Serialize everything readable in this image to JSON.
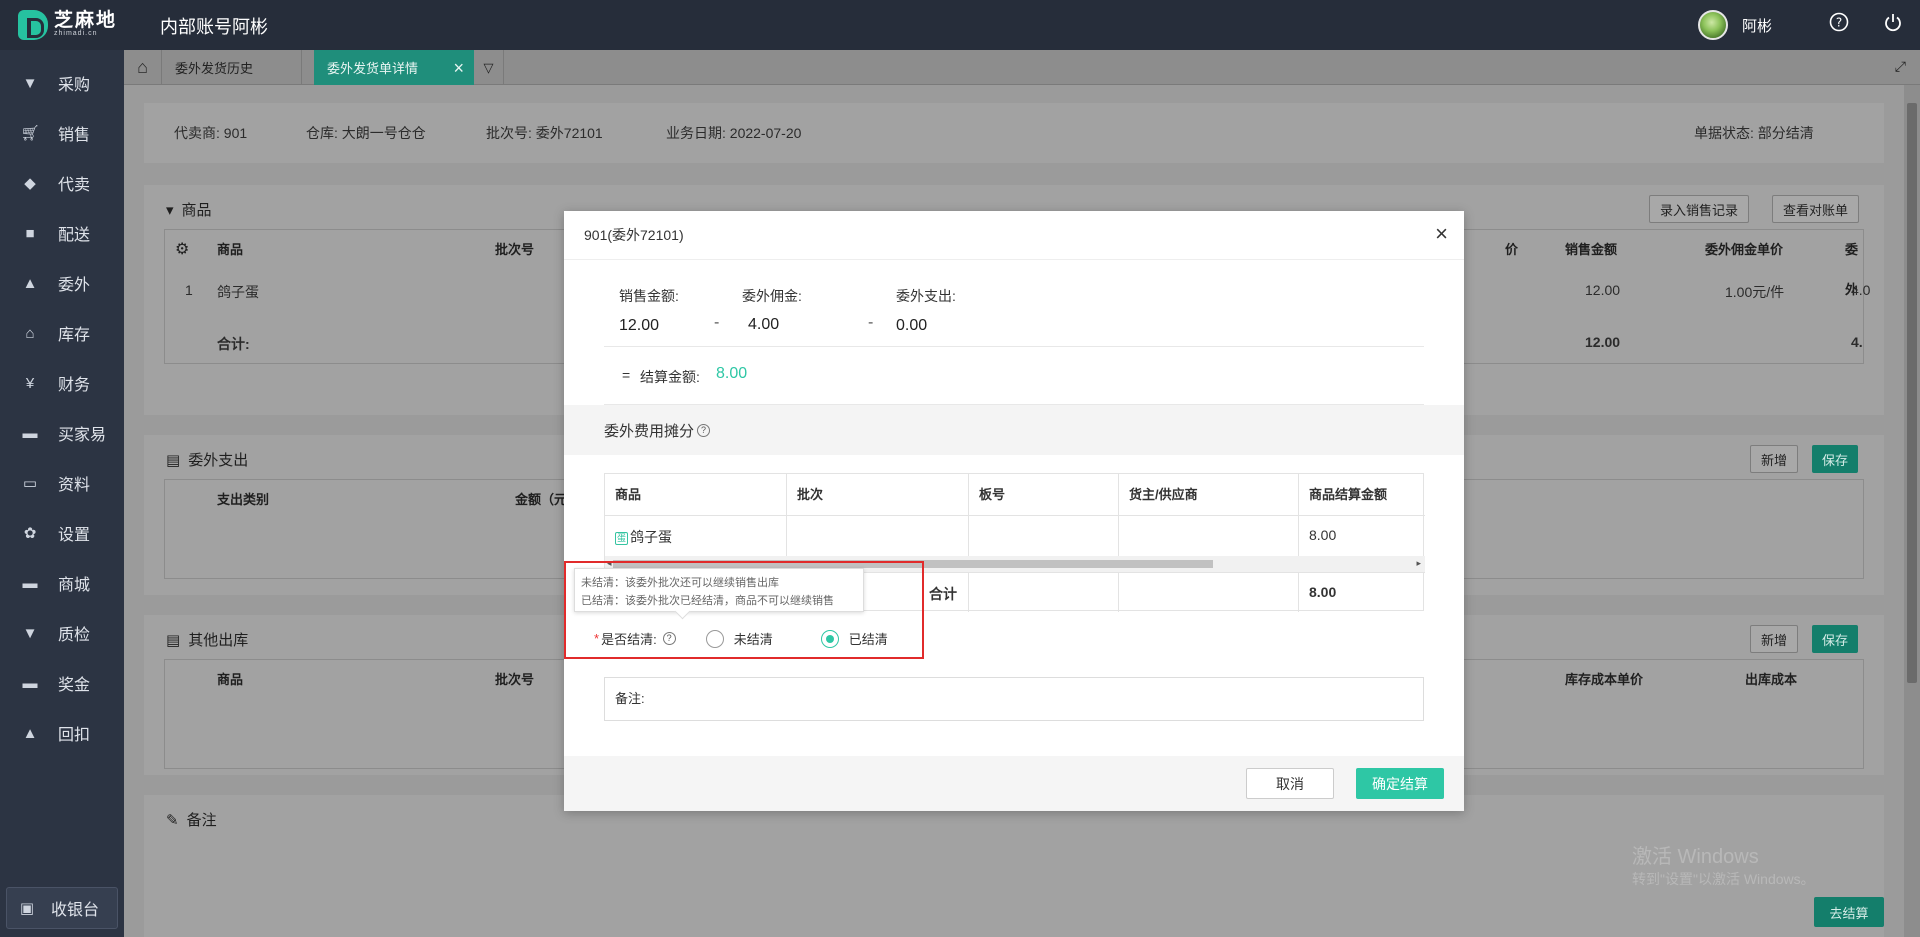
{
  "app": {
    "logo_text": "芝麻地",
    "logo_sub": "zhimadi.cn",
    "title": "内部账号阿彬",
    "user": "阿彬"
  },
  "icons": {
    "help": "help-circle-icon",
    "power": "power-icon",
    "home": "home-icon"
  },
  "sidebar": {
    "items": [
      {
        "label": "采购",
        "icon": "basket-icon"
      },
      {
        "label": "销售",
        "icon": "cart-icon"
      },
      {
        "label": "代卖",
        "icon": "tag-icon"
      },
      {
        "label": "配送",
        "icon": "truck-icon"
      },
      {
        "label": "委外",
        "icon": "building-icon"
      },
      {
        "label": "库存",
        "icon": "warehouse-icon"
      },
      {
        "label": "财务",
        "icon": "yen-icon"
      },
      {
        "label": "买家易",
        "icon": "store-icon"
      },
      {
        "label": "资料",
        "icon": "archive-icon"
      },
      {
        "label": "设置",
        "icon": "gear-icon"
      },
      {
        "label": "商城",
        "icon": "shop-icon"
      },
      {
        "label": "质检",
        "icon": "basket-check-icon"
      },
      {
        "label": "奖金",
        "icon": "bonus-icon"
      },
      {
        "label": "回扣",
        "icon": "rebate-icon"
      }
    ],
    "cashier": "收银台"
  },
  "tabs": [
    {
      "label": "委外发货历史",
      "active": false
    },
    {
      "label": "委外发货单详情",
      "active": true
    }
  ],
  "header_info": {
    "agent": "代卖商: 901",
    "warehouse": "仓库: 大朗一号仓仓",
    "batch": "批次号: 委外72101",
    "date": "业务日期:  2022-07-20",
    "status": "单据状态:  部分结清"
  },
  "goods_card": {
    "title": "商品",
    "btn_record": "录入销售记录",
    "btn_statement": "查看对账单",
    "columns": [
      "商品",
      "批次号",
      "价",
      "销售金额",
      "委外佣金单价",
      "委外"
    ],
    "row": {
      "index": "1",
      "name": "鸽子蛋",
      "sales": "12.00",
      "unit_commission": "1.00元/件",
      "out": "4.0"
    },
    "total_label": "合计:",
    "total_sales": "12.00",
    "total_out": "4."
  },
  "expense_card": {
    "title": "委外支出",
    "btn_add": "新增",
    "btn_save": "保存",
    "columns": [
      "支出类别",
      "金额（元"
    ]
  },
  "other_card": {
    "title": "其他出库",
    "btn_add": "新增",
    "btn_save": "保存",
    "columns": [
      "商品",
      "批次号",
      "库存成本单价",
      "出库成本"
    ]
  },
  "remark_card": {
    "title": "备注"
  },
  "settle_btn": "去结算",
  "watermark": {
    "line1": "激活 Windows",
    "line2": "转到\"设置\"以激活 Windows。"
  },
  "modal": {
    "title": "901(委外72101)",
    "sales_label": "销售金额:",
    "sales_value": "12.00",
    "commission_label": "委外佣金:",
    "commission_value": "4.00",
    "expense_label": "委外支出:",
    "expense_value": "0.00",
    "minus": "-",
    "equals": "=",
    "settle_label": "结算金额:",
    "settle_value": "8.00",
    "section_title": "委外费用摊分",
    "table": {
      "columns": [
        "商品",
        "批次",
        "板号",
        "货主/供应商",
        "商品结算金额"
      ],
      "row": {
        "name": "鸽子蛋",
        "batch": "",
        "board": "",
        "owner": "",
        "amount": "8.00"
      },
      "total_label": "合计",
      "total_amount": "8.00"
    },
    "tooltip": {
      "line1": "未结清：该委外批次还可以继续销售出库",
      "line2": "已结清：该委外批次已经结清，商品不可以继续销售"
    },
    "settled_label": "是否结清:",
    "options": [
      "未结清",
      "已结清"
    ],
    "selected": "已结清",
    "remark_label": "备注:",
    "cancel": "取消",
    "confirm": "确定结算"
  },
  "colors": {
    "accent": "#2ec7a5",
    "topbar": "#262d3a",
    "sidebar": "#2c3443",
    "alert": "#e12b2b"
  }
}
